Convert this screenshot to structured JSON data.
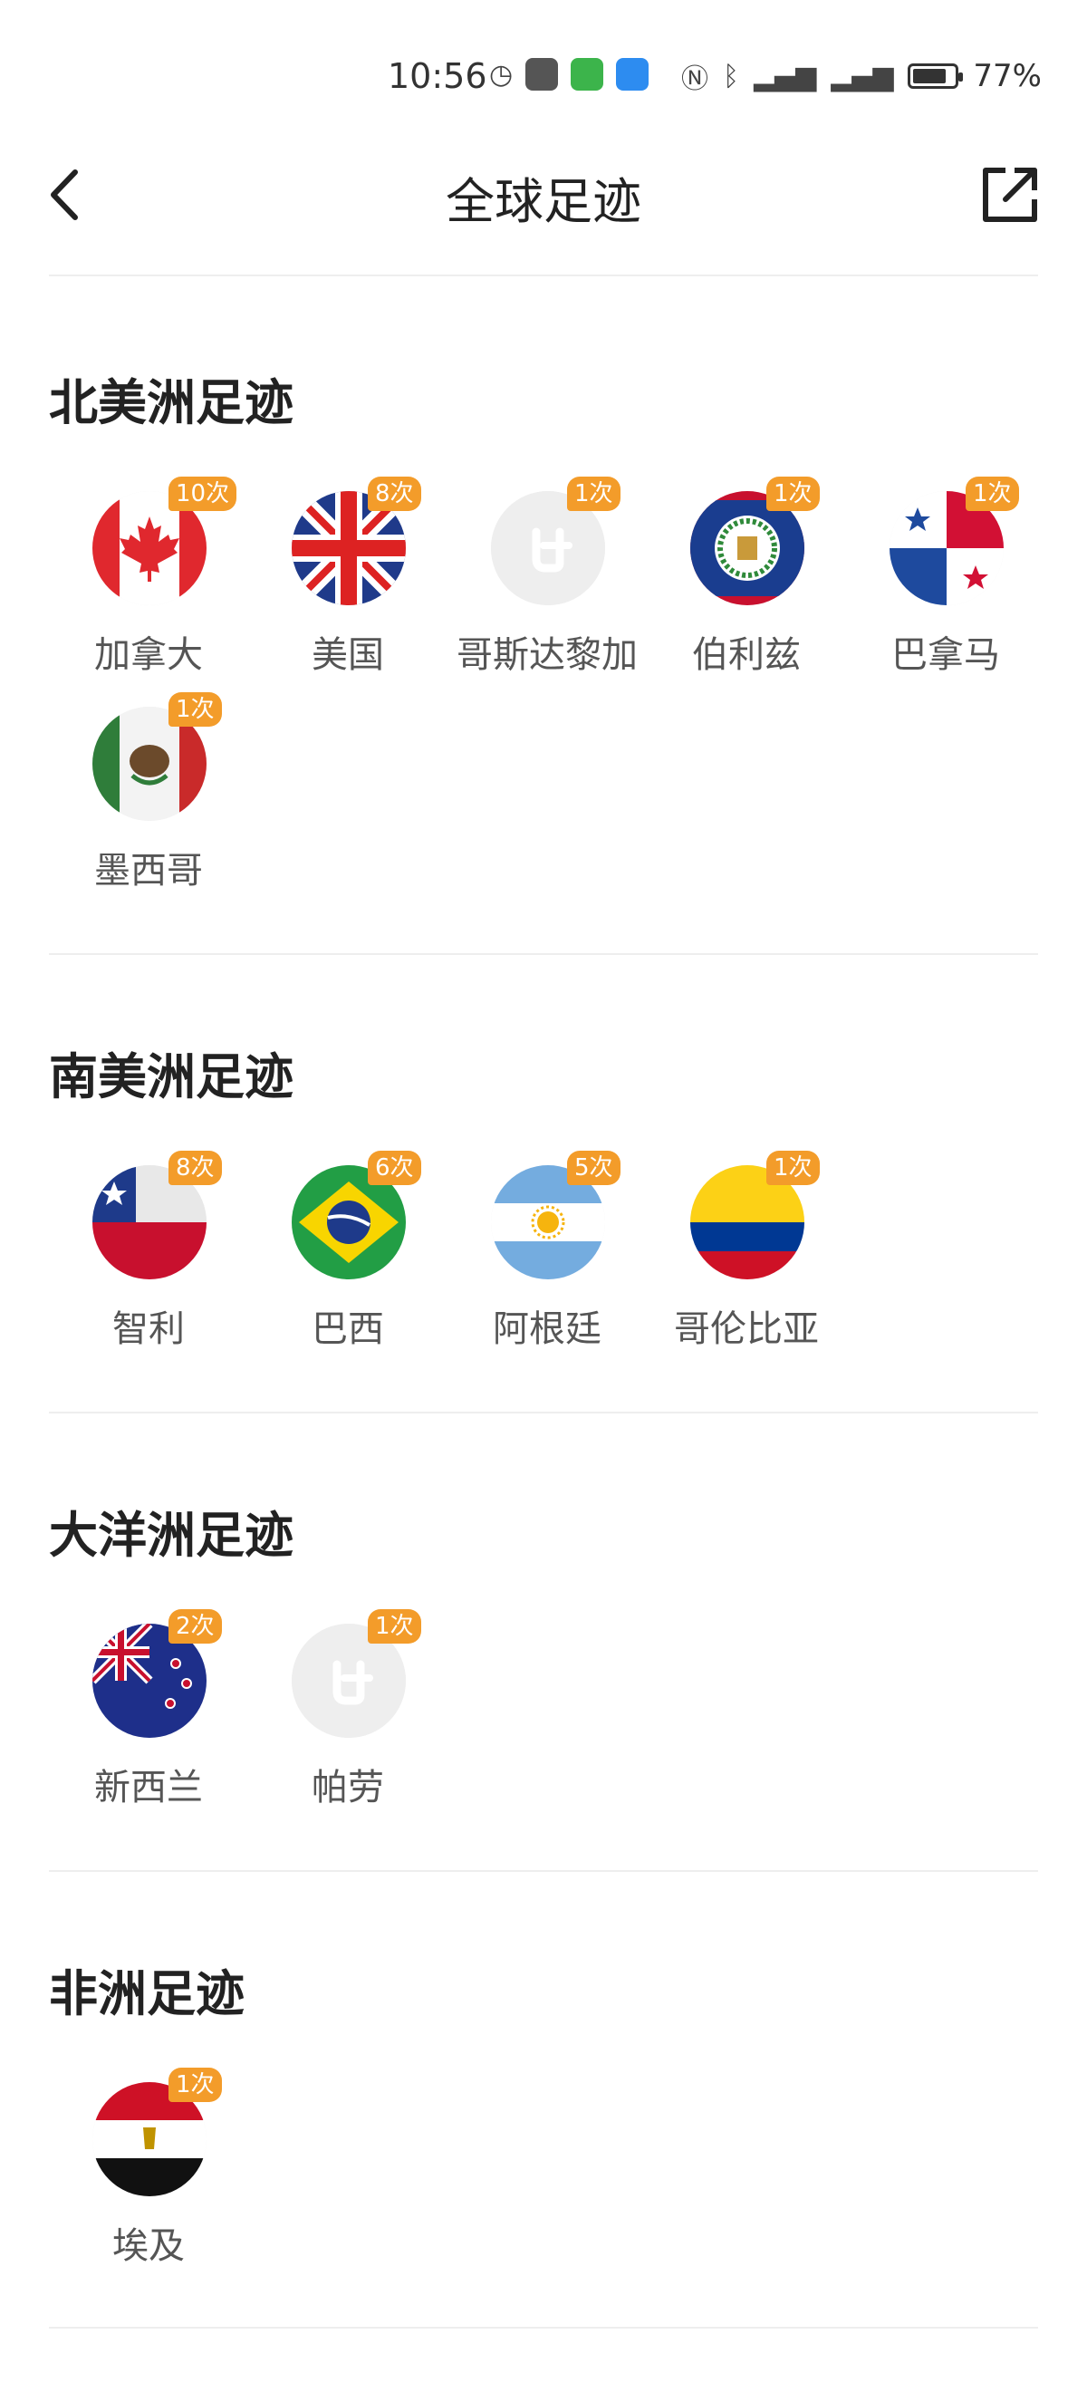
{
  "status_bar": {
    "time": "10:56",
    "battery": "77%",
    "icons": [
      "alarm-icon",
      "notification-icon",
      "app-icon",
      "weather-icon",
      "nfc-icon",
      "bluetooth-icon",
      "signal-5g-icon",
      "signal-4g-icon",
      "battery-icon"
    ]
  },
  "nav": {
    "title": "全球足迹",
    "back_icon": "chevron-left-icon",
    "share_icon": "share-icon"
  },
  "sections": [
    {
      "title": "北美洲足迹",
      "items": [
        {
          "name": "加拿大",
          "count": "10次",
          "flag": "canada"
        },
        {
          "name": "美国",
          "count": "8次",
          "flag": "uk"
        },
        {
          "name": "哥斯达黎加",
          "count": "1次",
          "flag": "placeholder"
        },
        {
          "name": "伯利兹",
          "count": "1次",
          "flag": "belize"
        },
        {
          "name": "巴拿马",
          "count": "1次",
          "flag": "panama"
        },
        {
          "name": "墨西哥",
          "count": "1次",
          "flag": "mexico"
        }
      ]
    },
    {
      "title": "南美洲足迹",
      "items": [
        {
          "name": "智利",
          "count": "8次",
          "flag": "chile"
        },
        {
          "name": "巴西",
          "count": "6次",
          "flag": "brazil"
        },
        {
          "name": "阿根廷",
          "count": "5次",
          "flag": "argentina"
        },
        {
          "name": "哥伦比亚",
          "count": "1次",
          "flag": "colombia"
        }
      ]
    },
    {
      "title": "大洋洲足迹",
      "items": [
        {
          "name": "新西兰",
          "count": "2次",
          "flag": "newzealand"
        },
        {
          "name": "帕劳",
          "count": "1次",
          "flag": "placeholder"
        }
      ]
    },
    {
      "title": "非洲足迹",
      "items": [
        {
          "name": "埃及",
          "count": "1次",
          "flag": "egypt"
        }
      ]
    }
  ],
  "colors": {
    "badge": "#f39c2a",
    "title": "#222222",
    "label": "#555555",
    "divider": "#eeeeee"
  }
}
